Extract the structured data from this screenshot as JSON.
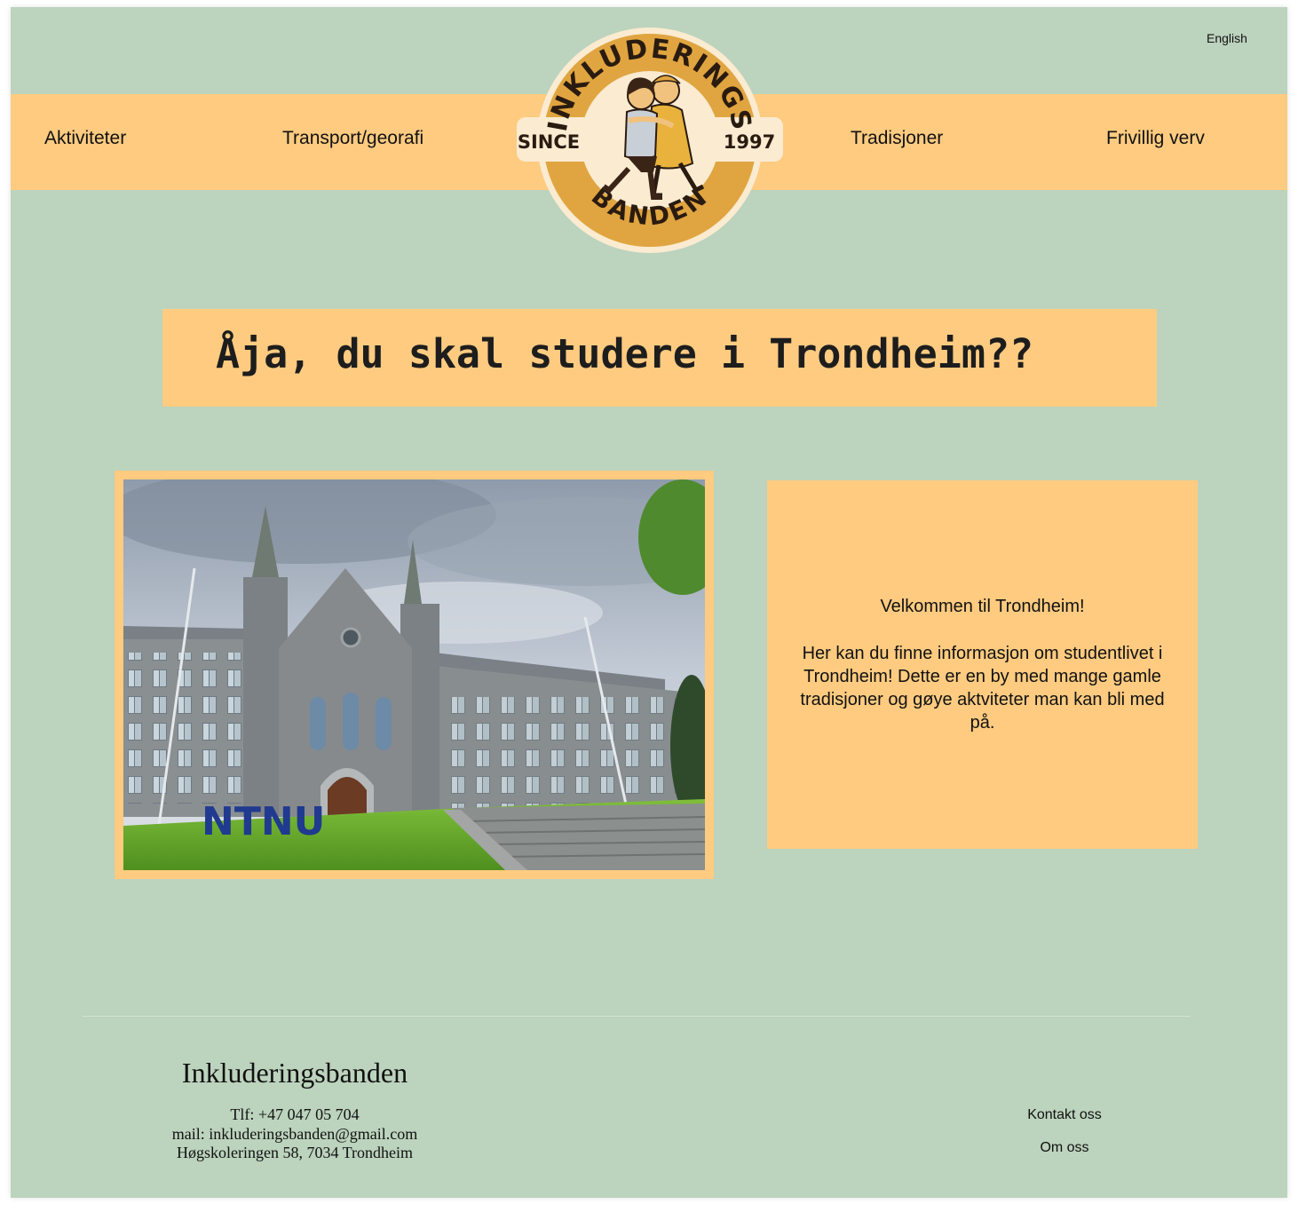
{
  "language_toggle": "English",
  "nav": {
    "items": [
      "Aktiviteter",
      "Transport/georafi",
      "Tradisjoner",
      "Frivillig verv"
    ]
  },
  "logo": {
    "top_text": "INKLUDERINGS",
    "bottom_text": "BANDEN",
    "left_text": "SINCE",
    "right_text": "1997"
  },
  "hero": {
    "headline": "Åja, du skal studere i Trondheim??"
  },
  "photo": {
    "sign_text": "NTNU"
  },
  "info": {
    "title": "Velkommen til Trondheim!",
    "body": "Her kan du finne informasjon om studentlivet i Trondheim! Dette er en by med mange gamle tradisjoner og gøye aktviteter man kan bli med på."
  },
  "footer": {
    "brand": "Inkluderingsbanden",
    "phone": "Tlf: +47 047 05 704",
    "email": "mail: inkluderingsbanden@gmail.com",
    "address": "Høgskoleringen 58,  7034 Trondheim",
    "links": [
      "Kontakt oss",
      "Om oss"
    ]
  },
  "colors": {
    "page_background": "#bcd3bd",
    "accent": "#fecb80",
    "logo_ring": "#e0a540",
    "logo_inner": "#faebd1"
  }
}
